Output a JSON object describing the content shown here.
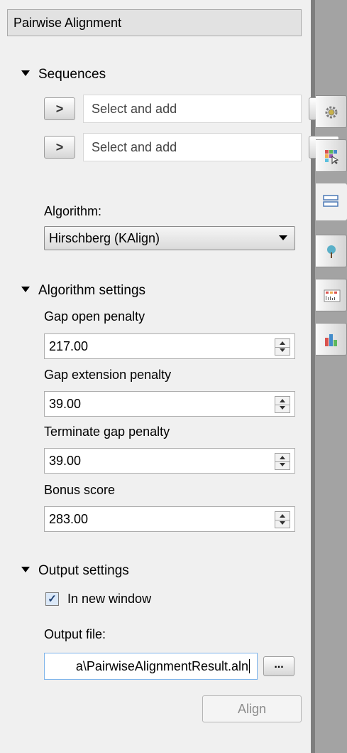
{
  "panel": {
    "title": "Pairwise Alignment"
  },
  "sequences": {
    "header": "Sequences",
    "rows": [
      {
        "add_label": ">",
        "placeholder": "Select and add",
        "remove_label": "✕"
      },
      {
        "add_label": ">",
        "placeholder": "Select and add",
        "remove_label": "✕"
      }
    ]
  },
  "algorithm": {
    "label": "Algorithm:",
    "selected": "Hirschberg (KAlign)"
  },
  "algorithm_settings": {
    "header": "Algorithm settings",
    "gap_open": {
      "label": "Gap open penalty",
      "value": "217.00"
    },
    "gap_extension": {
      "label": "Gap extension penalty",
      "value": "39.00"
    },
    "terminate_gap": {
      "label": "Terminate gap penalty",
      "value": "39.00"
    },
    "bonus": {
      "label": "Bonus score",
      "value": "283.00"
    }
  },
  "output_settings": {
    "header": "Output settings",
    "in_new_window": {
      "label": "In new window",
      "checked": true
    },
    "output_file_label": "Output file:",
    "output_file_value": "a\\PairwiseAlignmentResult.aln",
    "browse_label": "..."
  },
  "actions": {
    "align_label": "Align"
  },
  "side_tabs": [
    {
      "icon": "gear-icon"
    },
    {
      "icon": "color-grid-cursor-icon"
    },
    {
      "icon": "alignment-rows-icon"
    },
    {
      "icon": "tree-icon"
    },
    {
      "icon": "statistics-table-icon"
    },
    {
      "icon": "bar-chart-icon"
    }
  ]
}
